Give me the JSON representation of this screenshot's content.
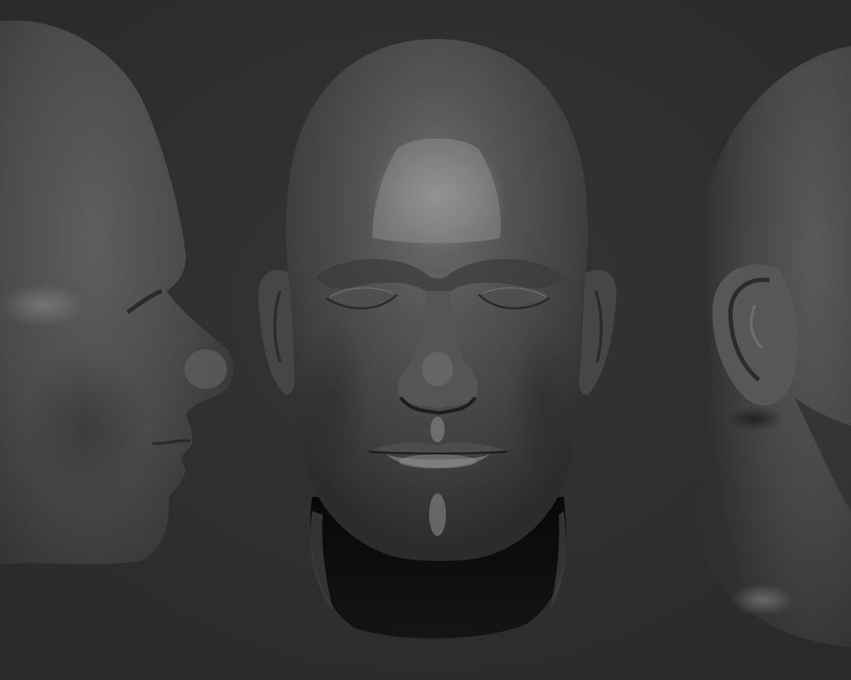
{
  "scene": {
    "background_color": "#2f2f2f",
    "material": "matte-gray-clay",
    "material_base_color": "#4a4a4a",
    "highlight_color": "#9a9a9a",
    "shadow_color": "#0c0c0c",
    "views": [
      {
        "name": "side-profile-view",
        "icon": "head-profile-icon"
      },
      {
        "name": "front-view",
        "icon": "head-front-icon"
      },
      {
        "name": "back-three-quarter-view",
        "icon": "head-back-icon"
      }
    ]
  }
}
